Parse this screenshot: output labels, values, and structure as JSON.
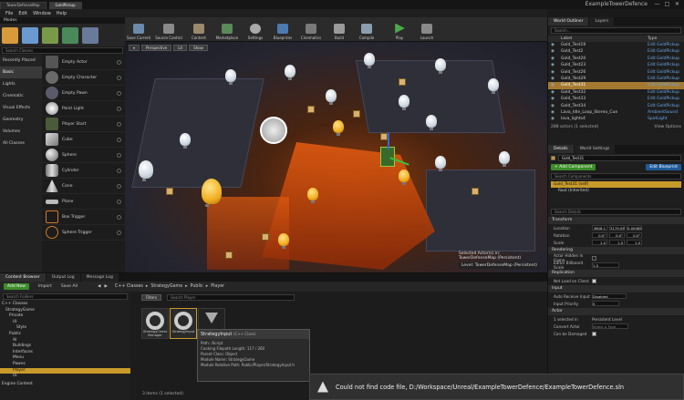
{
  "window": {
    "tabs": [
      "TowerDefenseMap",
      "GoldPickup"
    ],
    "app_title": "ExampleTowerDefence",
    "controls": [
      "—",
      "□",
      "✕"
    ]
  },
  "menu": [
    "File",
    "Edit",
    "Window",
    "Help"
  ],
  "modes_panel": {
    "title": "Modes",
    "search_placeholder": "Search Classes",
    "categories": [
      "Recently Placed",
      "Basic",
      "Lights",
      "Cinematic",
      "Visual Effects",
      "Geometry",
      "Volumes",
      "All Classes"
    ],
    "selected_category": "Basic",
    "items": [
      "Empty Actor",
      "Empty Character",
      "Empty Pawn",
      "Point Light",
      "Player Start",
      "Cube",
      "Sphere",
      "Cylinder",
      "Cone",
      "Plane",
      "Box Trigger",
      "Sphere Trigger"
    ]
  },
  "toolbar": {
    "buttons": [
      "Save Current",
      "Source Control",
      "Content",
      "Marketplace",
      "Settings",
      "Blueprints",
      "Cinematics",
      "Build",
      "Compile",
      "Play",
      "Launch"
    ]
  },
  "viewport": {
    "buttons": [
      "Perspective",
      "Lit",
      "Show"
    ],
    "info_line1": "Selected Actor(s) in:",
    "info_line2": "TowerDefenseMap (Persistent)",
    "level_label": "Level:",
    "level_value": "TowerDefenseMap (Persistent)"
  },
  "outliner": {
    "tabs": [
      "World Outliner",
      "Layers"
    ],
    "search_placeholder": "Search...",
    "col_label": "Label",
    "col_type": "Type",
    "rows": [
      {
        "name": "Gold_Test19",
        "type": "Edit GoldPickup"
      },
      {
        "name": "Gold_Test2",
        "type": "Edit GoldPickup"
      },
      {
        "name": "Gold_Test20",
        "type": "Edit GoldPickup"
      },
      {
        "name": "Gold_Test23",
        "type": "Edit GoldPickup"
      },
      {
        "name": "Gold_Test26",
        "type": "Edit GoldPickup"
      },
      {
        "name": "Gold_Test29",
        "type": "Edit GoldPickup"
      },
      {
        "name": "Gold_Test31",
        "type": "Edit GoldPickup"
      },
      {
        "name": "Gold_Test32",
        "type": "Edit GoldPickup"
      },
      {
        "name": "Gold_Test33",
        "type": "Edit GoldPickup"
      },
      {
        "name": "Gold_Test34",
        "type": "Edit GoldPickup"
      },
      {
        "name": "Lava_Idle_Loop_Stereo_Cue",
        "type": "AmbientSound"
      },
      {
        "name": "lava_lights4",
        "type": "SpotLight"
      }
    ],
    "selected_index": 6,
    "footer": "288 actors (1 selected)",
    "view_options": "View Options"
  },
  "details": {
    "tabs": [
      "Details",
      "World Settings"
    ],
    "actor_name": "Gold_Test31",
    "add_component": "+ Add Component",
    "edit_blueprint": "Edit Blueprint",
    "search_components": "Search Components",
    "component_self": "Gold_Test31 (self)",
    "component_root": "Root (Inherited)",
    "search_details": "Search Details",
    "transform": {
      "title": "Transform",
      "location_label": "Location",
      "location": [
        "3808.1",
        "3179.09",
        "0.00085"
      ],
      "rotation_label": "Rotation",
      "rotation": [
        "0.0°",
        "0.0°",
        "0.0°"
      ],
      "scale_label": "Scale",
      "scale": [
        "1.0",
        "1.0",
        "1.0"
      ]
    },
    "rendering": {
      "title": "Rendering",
      "hidden_label": "Actor Hidden In Game",
      "billboard_label": "Editor Billboard Scale",
      "billboard_value": "1.0"
    },
    "replication": {
      "title": "Replication",
      "net_load_label": "Net Load on Client"
    },
    "input": {
      "title": "Input",
      "auto_receive_label": "Auto Receive Input",
      "auto_receive_value": "Disabled",
      "priority_label": "Input Priority",
      "priority_value": "0"
    },
    "actor": {
      "title": "Actor",
      "selected_label": "1 selected in",
      "selected_value": "Persistent Level",
      "convert_label": "Convert Actor",
      "convert_value": "Select a Type",
      "damaged_label": "Can be Damaged"
    }
  },
  "content_browser": {
    "tabs": [
      "Content Browser",
      "Output Log",
      "Message Log"
    ],
    "add_new": "Add New",
    "import": "Import",
    "save_all": "Save All",
    "breadcrumb": [
      "C++ Classes",
      "StrategyGame",
      "Public",
      "Player"
    ],
    "search_folders": "Search Folders",
    "filters": "Filters",
    "search_assets": "Search Player",
    "tree": [
      "C++ Classes",
      "StrategyGame",
      "Private",
      "UI",
      "Style",
      "Public",
      "AI",
      "Buildings",
      "Interfaces",
      "Menu",
      "Pawns",
      "Player",
      "UI"
    ],
    "selected_tree_index": 11,
    "engine_content": "Engine Content",
    "assets": [
      "StrategyCheat Manager",
      "StrategyInput",
      ""
    ],
    "status": "3 items (1 selected)",
    "tooltip": {
      "title": "StrategyInput",
      "subtitle": "(C++ Class)",
      "lines": [
        "Path: /Script",
        "Cooking Filepath Length: 117 / 260",
        "Parent Class: Object",
        "Module Name: StrategyGame",
        "Module Relative Path: Public/Player/StrategyInput.h"
      ]
    }
  },
  "notification": {
    "text": "Could not find code file, D:/Workspace/Unreal/ExampleTowerDefence/ExampleTowerDefence.sln"
  },
  "colors": {
    "accent_orange": "#c89a2a",
    "add_green": "#3d8c2a",
    "blueprint_blue": "#1f5a9a",
    "type_blue": "#6aa8e8"
  }
}
